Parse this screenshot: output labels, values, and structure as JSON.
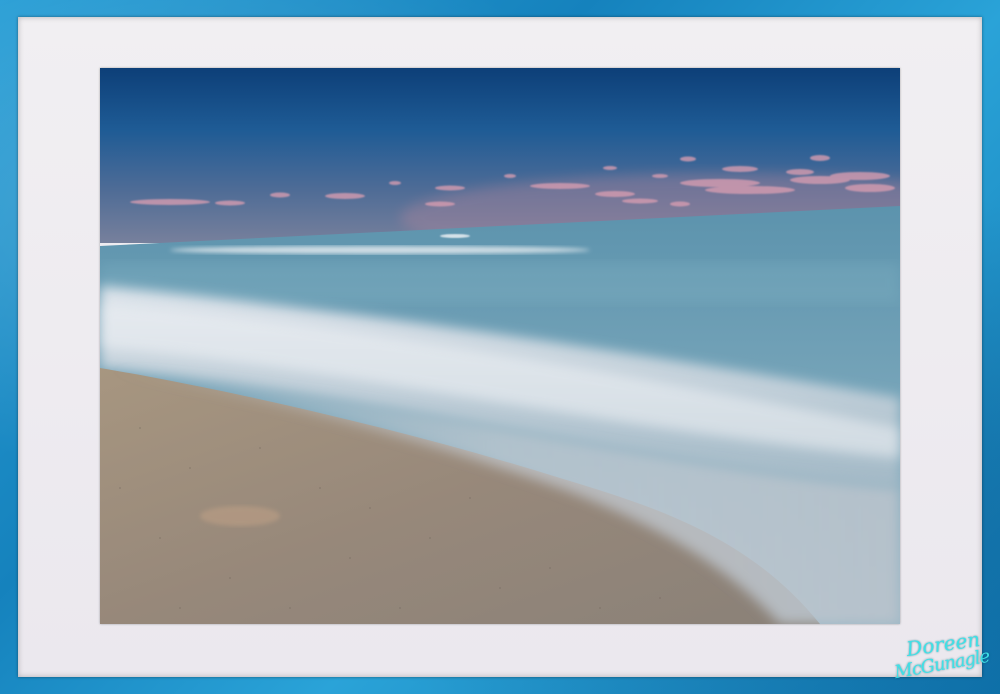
{
  "image": {
    "description_colors": {
      "frame": "#1f8fc4",
      "mat": "#eeecf0",
      "sky_top": "#0f4f8c",
      "sky_horizon": "#6f7d9e",
      "cloud": "#d9a3b4",
      "sea": "#6a9fb4",
      "surf": "#dfe4ea",
      "sand": "#9a8b77"
    }
  },
  "signature": {
    "line1": "Doreen",
    "line2": "McGunagle"
  }
}
